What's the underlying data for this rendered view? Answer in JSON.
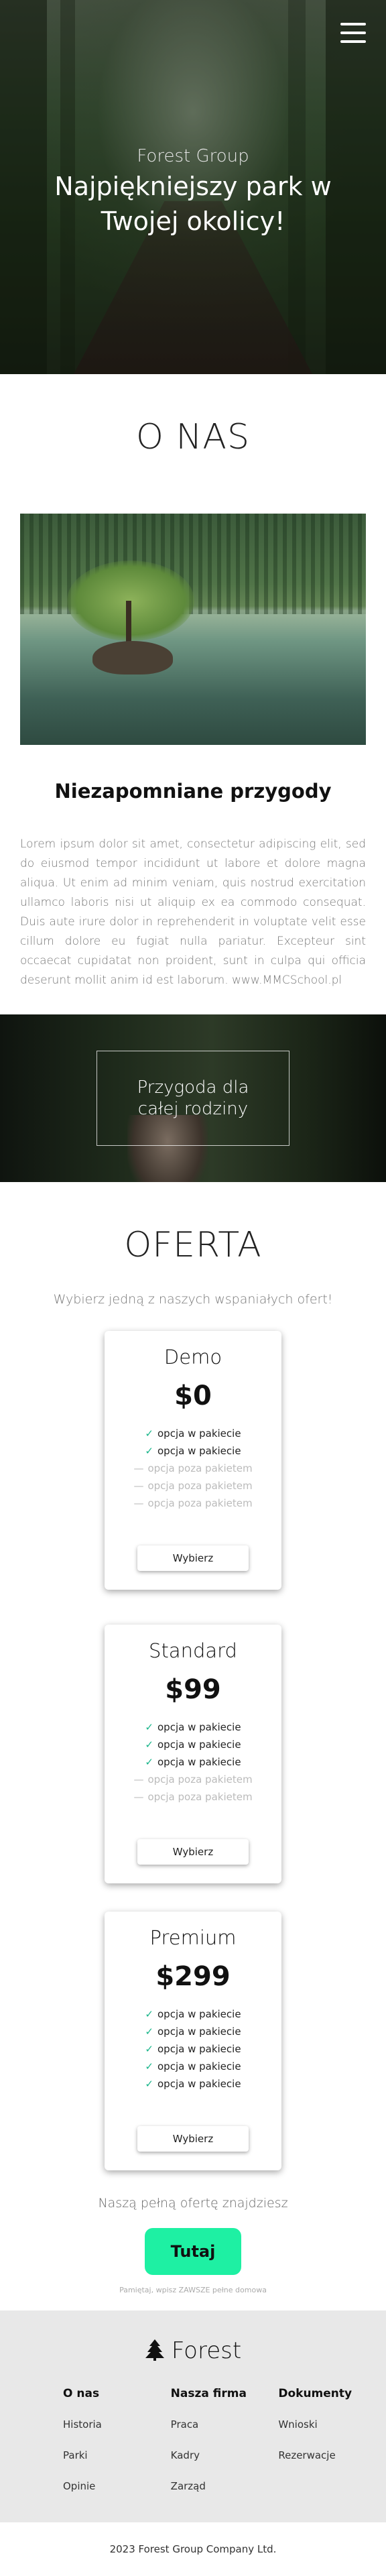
{
  "hero": {
    "brand": "Forest Group",
    "headline": "Najpiękniejszy park w Twojej okolicy!",
    "menu_icon": "hamburger-menu-icon"
  },
  "about": {
    "title": "O NAS",
    "heading": "Niezapomniane przygody",
    "text": "Lorem ipsum dolor sit amet, consectetur adipiscing elit, sed do eiusmod tempor incididunt ut labore et dolore magna aliqua. Ut enim ad minim veniam, quis nostrud exercitation ullamco laboris nisi ut aliquip ex ea commodo consequat. Duis aute irure dolor in reprehenderit in voluptate velit esse cillum dolore eu fugiat nulla pariatur. Excepteur sint occaecat cupidatat non proident, sunt in culpa qui officia deserunt mollit anim id est laborum. www.MMCSchool.pl"
  },
  "family_banner": {
    "line1": "Przygoda dla",
    "line2": "całej rodziny"
  },
  "offer": {
    "title": "OFERTA",
    "subtitle": "Wybierz jedną z naszych wspaniałych ofert!",
    "plans": [
      {
        "name": "Demo",
        "price": "$0",
        "included": [
          "opcja w pakiecie",
          "opcja w pakiecie"
        ],
        "excluded": [
          "opcja poza pakietem",
          "opcja poza pakietem",
          "opcja poza pakietem"
        ],
        "button": "Wybierz"
      },
      {
        "name": "Standard",
        "price": "$99",
        "included": [
          "opcja w pakiecie",
          "opcja w pakiecie",
          "opcja w pakiecie"
        ],
        "excluded": [
          "opcja poza pakietem",
          "opcja poza pakietem"
        ],
        "button": "Wybierz"
      },
      {
        "name": "Premium",
        "price": "$299",
        "included": [
          "opcja w pakiecie",
          "opcja w pakiecie",
          "opcja w pakiecie",
          "opcja w pakiecie",
          "opcja w pakiecie"
        ],
        "excluded": [],
        "button": "Wybierz"
      }
    ],
    "check_icon": "check-icon",
    "dash_icon": "dash-icon",
    "full_offer_text": "Naszą pełną ofertę znajdziesz",
    "cta": "Tutaj",
    "remark": "Pamiętaj, wpisz ZAWSZE pełne domowa"
  },
  "footer": {
    "logo_text": "Forest",
    "logo_icon": "pine-tree-icon",
    "columns": [
      {
        "title": "O nas",
        "links": [
          "Historia",
          "Parki",
          "Opinie"
        ]
      },
      {
        "title": "Nasza firma",
        "links": [
          "Praca",
          "Kadry",
          "Zarząd"
        ]
      },
      {
        "title": "Dokumenty",
        "links": [
          "Wnioski",
          "Rezerwacje"
        ]
      }
    ],
    "copyright": "2023 Forest Group Company Ltd."
  },
  "colors": {
    "accent": "#1ef0a3",
    "check": "#19b58a"
  }
}
